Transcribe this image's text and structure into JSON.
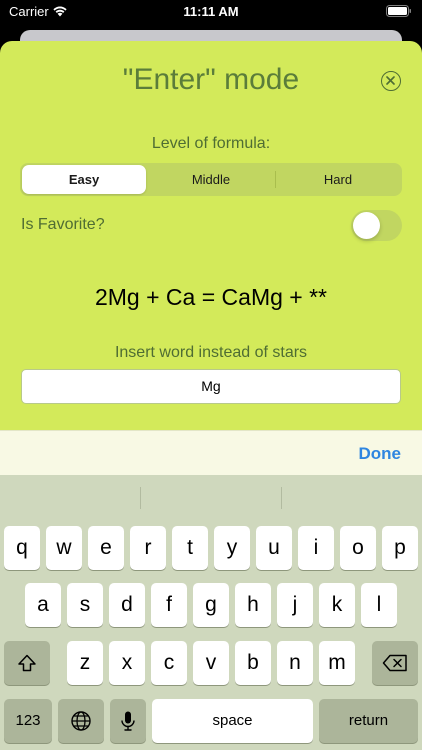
{
  "status_bar": {
    "carrier": "Carrier",
    "time": "11:11 AM"
  },
  "sheet": {
    "title": "\"Enter\" mode",
    "level_label": "Level of formula:",
    "levels": [
      "Easy",
      "Middle",
      "Hard"
    ],
    "selected_level": "Easy",
    "favorite_label": "Is Favorite?",
    "favorite_on": false,
    "formula": "2Mg + Ca = CaMg + **",
    "insert_label": "Insert word instead of stars",
    "answer_value": "Mg"
  },
  "accessory": {
    "done_label": "Done"
  },
  "keyboard": {
    "row1": [
      "q",
      "w",
      "e",
      "r",
      "t",
      "y",
      "u",
      "i",
      "o",
      "p"
    ],
    "row2": [
      "a",
      "s",
      "d",
      "f",
      "g",
      "h",
      "j",
      "k",
      "l"
    ],
    "row3": [
      "z",
      "x",
      "c",
      "v",
      "b",
      "n",
      "m"
    ],
    "numbers_label": "123",
    "space_label": "space",
    "return_label": "return"
  },
  "colors": {
    "sheet_bg": "#d3ea5a",
    "accent_text": "#5b7d3a",
    "done_blue": "#2f86e0",
    "keyboard_bg": "#cfd8bd"
  },
  "icons": [
    "wifi-icon",
    "battery-icon",
    "close-icon",
    "shift-icon",
    "backspace-icon",
    "globe-icon",
    "microphone-icon"
  ]
}
